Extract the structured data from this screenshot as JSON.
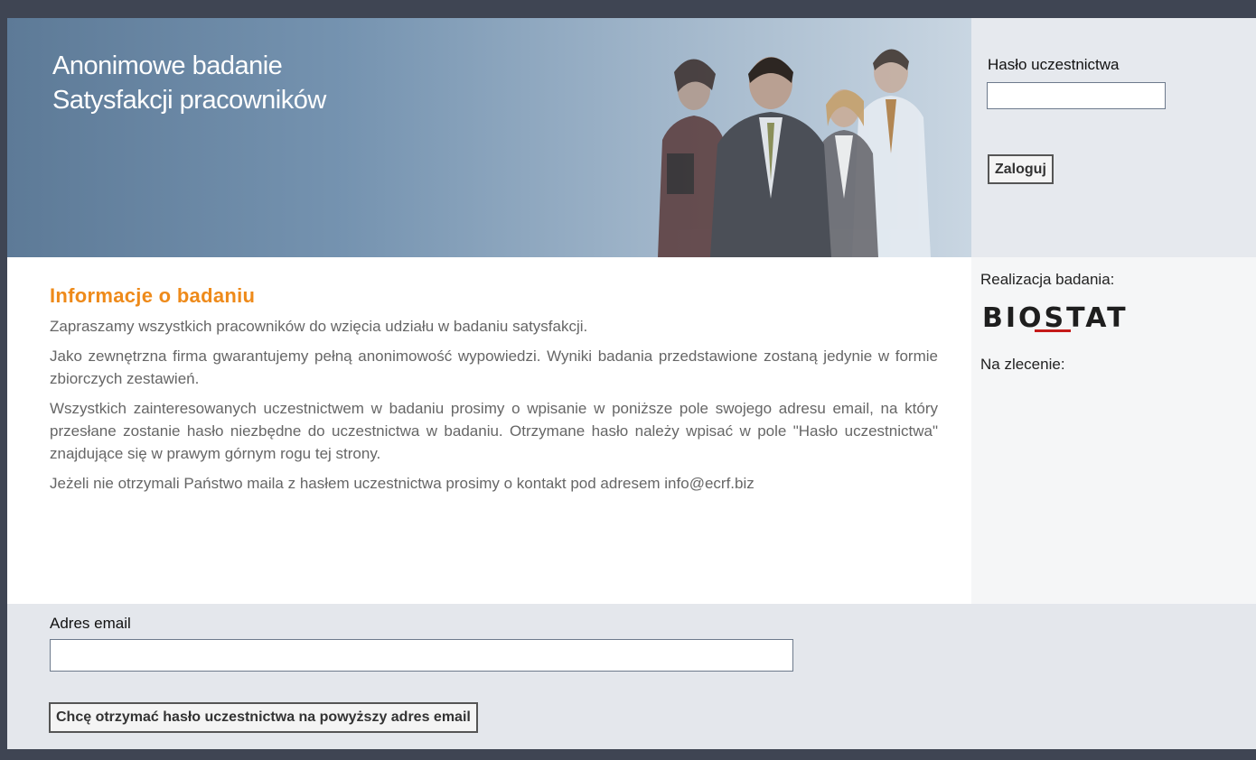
{
  "header": {
    "title_line1": "Anonimowe badanie",
    "title_line2": "Satysfakcji pracowników"
  },
  "login": {
    "label": "Hasło uczestnictwa",
    "value": "",
    "button": "Zaloguj"
  },
  "sidebar": {
    "realization_label": "Realizacja badania:",
    "logo_text": "BIOSTAT",
    "commission_label": "Na zlecenie:"
  },
  "main": {
    "heading": "Informacje o badaniu",
    "paragraphs": [
      "Zapraszamy wszystkich pracowników do wzięcia udziału w badaniu satysfakcji.",
      "Jako zewnętrzna firma gwarantujemy pełną anonimowość wypowiedzi. Wyniki badania przedstawione zostaną jedynie w formie zbiorczych zestawień.",
      "Wszystkich zainteresowanych uczestnictwem w badaniu prosimy o wpisanie w poniższe pole swojego adresu email, na który przesłane zostanie hasło niezbędne do uczestnictwa w badaniu. Otrzymane hasło należy wpisać w pole \"Hasło uczestnictwa\" znajdujące się w prawym górnym rogu tej strony.",
      "Jeżeli nie otrzymali Państwo maila z hasłem uczestnictwa prosimy o kontakt pod adresem info@ecrf.biz"
    ]
  },
  "email_form": {
    "label": "Adres email",
    "value": "",
    "button": "Chcę otrzymać hasło uczestnictwa na powyższy adres email"
  },
  "colors": {
    "heading_accent": "#ee8a1a",
    "frame": "#3f4553",
    "panel": "#e6e9ee"
  }
}
